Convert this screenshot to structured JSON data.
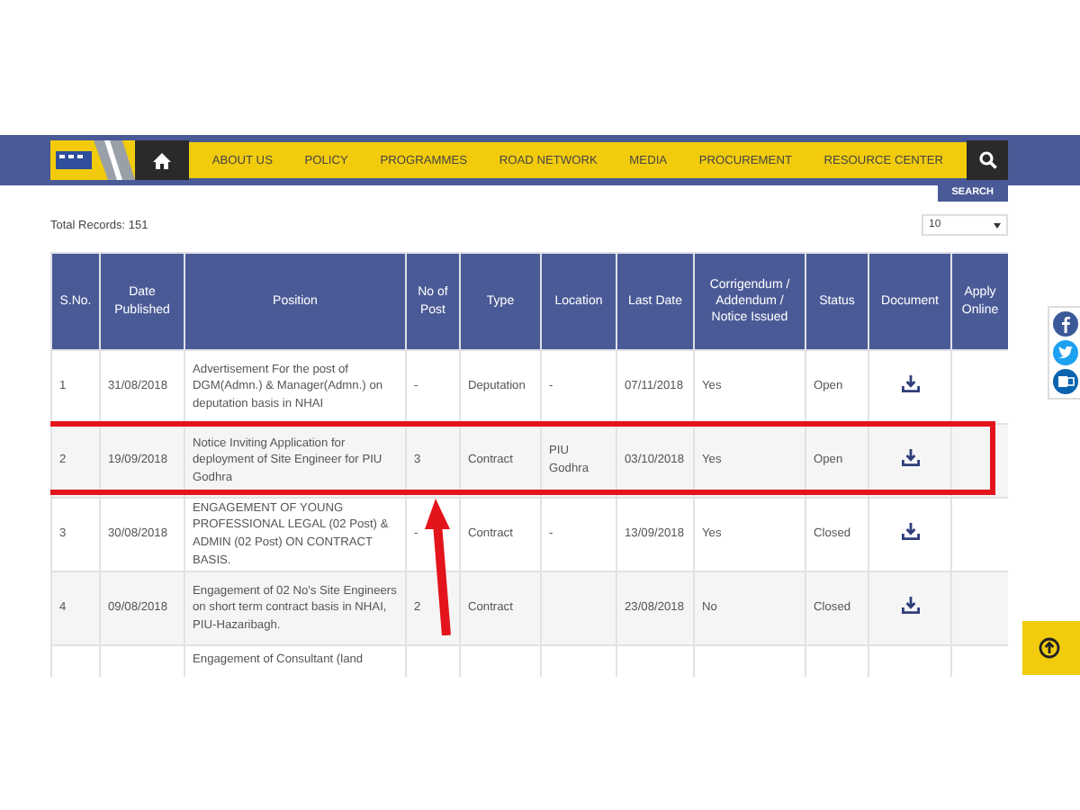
{
  "nav": {
    "items": [
      "ABOUT US",
      "POLICY",
      "PROGRAMMES",
      "ROAD NETWORK",
      "MEDIA",
      "PROCUREMENT",
      "RESOURCE CENTER"
    ]
  },
  "search_button": "SEARCH",
  "total_records": "Total Records: 151",
  "page_size": {
    "value": "10"
  },
  "table": {
    "columns": [
      "S.No.",
      "Date Published",
      "Position",
      "No of Post",
      "Type",
      "Location",
      "Last Date",
      "Corrigendum / Addendum / Notice Issued",
      "Status",
      "Document",
      "Apply Online"
    ],
    "rows": [
      {
        "sno": "1",
        "date": "31/08/2018",
        "position": "Advertisement For the post of DGM(Admn.) & Manager(Admn.) on deputation basis in NHAI",
        "posts": "-",
        "type": "Deputation",
        "location": "-",
        "last_date": "07/11/2018",
        "corrigendum": "Yes",
        "status": "Open",
        "highlighted": false
      },
      {
        "sno": "2",
        "date": "19/09/2018",
        "position": "Notice Inviting Application for deployment of Site Engineer for PIU Godhra",
        "posts": "3",
        "type": "Contract",
        "location": "PIU Godhra",
        "last_date": "03/10/2018",
        "corrigendum": "Yes",
        "status": "Open",
        "highlighted": true
      },
      {
        "sno": "3",
        "date": "30/08/2018",
        "position": "ENGAGEMENT OF YOUNG PROFESSIONAL LEGAL (02 Post) & ADMIN (02 Post) ON CONTRACT BASIS.",
        "posts": "-",
        "type": "Contract",
        "location": "-",
        "last_date": "13/09/2018",
        "corrigendum": "Yes",
        "status": "Closed",
        "highlighted": false
      },
      {
        "sno": "4",
        "date": "09/08/2018",
        "position": "Engagement of 02 No's Site Engineers on short term contract basis in NHAI, PIU-Hazaribagh.",
        "posts": "2",
        "type": "Contract",
        "location": "",
        "last_date": "23/08/2018",
        "corrigendum": "No",
        "status": "Closed",
        "highlighted": false
      },
      {
        "sno": "",
        "date": "",
        "position": "Engagement of Consultant (land",
        "posts": "",
        "type": "",
        "location": "",
        "last_date": "",
        "corrigendum": "",
        "status": "",
        "highlighted": false
      }
    ]
  }
}
